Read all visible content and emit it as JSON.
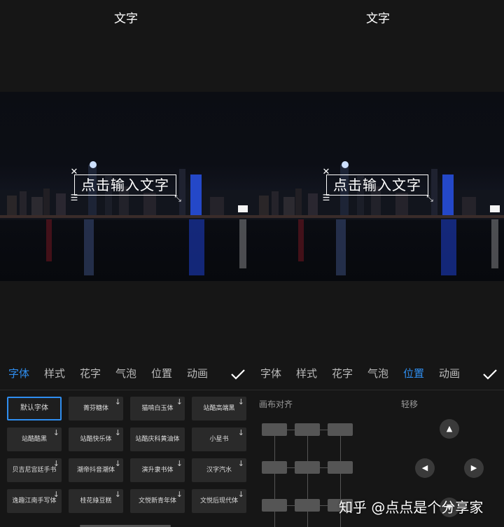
{
  "left": {
    "title": "文字",
    "placeholder": "点击输入文字",
    "tabs": [
      "字体",
      "样式",
      "花字",
      "气泡",
      "位置",
      "动画"
    ],
    "active_tab": 0,
    "fonts": [
      {
        "label": "默认字体",
        "selected": true,
        "download": false
      },
      {
        "label": "菁芬糖体",
        "selected": false,
        "download": true
      },
      {
        "label": "猫啃白玉体",
        "selected": false,
        "download": true
      },
      {
        "label": "站酷高端黑",
        "selected": false,
        "download": true
      },
      {
        "label": "站酷酷黑",
        "selected": false,
        "download": true
      },
      {
        "label": "站酷快乐体",
        "selected": false,
        "download": true
      },
      {
        "label": "站酷庆科黄油体",
        "selected": false,
        "download": false
      },
      {
        "label": "小星书",
        "selected": false,
        "download": true
      },
      {
        "label": "贝吉尼宫廷手书",
        "selected": false,
        "download": true
      },
      {
        "label": "潮帝抖音潮体",
        "selected": false,
        "download": true
      },
      {
        "label": "演升隶书体",
        "selected": false,
        "download": true
      },
      {
        "label": "汉字汽水",
        "selected": false,
        "download": true
      },
      {
        "label": "逸趣江南手写体",
        "selected": false,
        "download": true
      },
      {
        "label": "桂花綠豆糕",
        "selected": false,
        "download": true
      },
      {
        "label": "文悦新青年体",
        "selected": false,
        "download": true
      },
      {
        "label": "文悦后现代体",
        "selected": false,
        "download": true
      }
    ]
  },
  "right": {
    "title": "文字",
    "placeholder": "点击输入文字",
    "tabs": [
      "字体",
      "样式",
      "花字",
      "气泡",
      "位置",
      "动画"
    ],
    "active_tab": 4,
    "canvas_align_label": "画布对齐",
    "nudge_label": "轻移"
  },
  "watermark": "知乎 @点点是个分享家",
  "colors": {
    "accent": "#2f8ef0",
    "panel_bg": "#161616",
    "cell_bg": "#2a2a2a"
  }
}
